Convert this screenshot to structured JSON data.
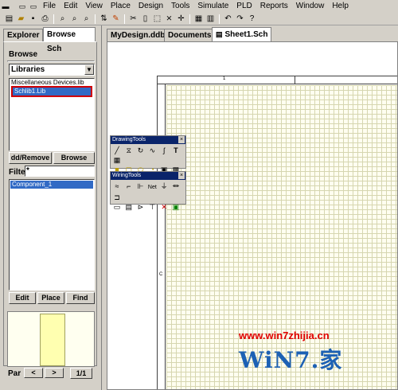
{
  "menubar": {
    "items": [
      "File",
      "Edit",
      "View",
      "Place",
      "Design",
      "Tools",
      "Simulate",
      "PLD",
      "Reports",
      "Window",
      "Help"
    ]
  },
  "left_panel": {
    "tabs": [
      "Explorer",
      "Browse Sch"
    ],
    "browse_label": "Browse",
    "libraries_value": "Libraries",
    "library_items": [
      "Miscellaneous Devices.lib",
      "Schlib1.Lib"
    ],
    "add_remove_label": "dd/Remove",
    "browse_button": "Browse",
    "filter_label": "Filte",
    "filter_value": "*",
    "components": [
      "Component_1"
    ],
    "edit_button": "Edit",
    "place_button": "Place",
    "find_button": "Find",
    "part_label": "Par",
    "part_count": "1/1"
  },
  "doc_tabs": [
    "MyDesign.ddb",
    "Documents",
    "Sheet1.Sch"
  ],
  "sheet": {
    "ruler_top": "1",
    "ruler_left": "C"
  },
  "drawing_tools": {
    "title": "DrawingTools"
  },
  "wiring_tools": {
    "title": "WiringTools"
  },
  "watermark": {
    "url": "www.win7zhijia.cn",
    "logo": "WiN7.家"
  },
  "colors": {
    "selection": "#316ac5",
    "title_bar": "#0a246a",
    "highlight_box": "#d00000",
    "grid_line": "#d6d6b0"
  }
}
